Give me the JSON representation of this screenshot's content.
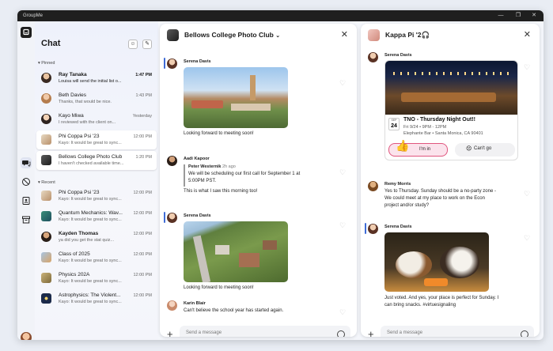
{
  "app": {
    "title": "GroupMe"
  },
  "window_controls": {
    "minimize": "—",
    "maximize": "❐",
    "close": "✕"
  },
  "sidebar": {
    "title": "Chat",
    "pinned_label": "Pinned",
    "recent_label": "Recent",
    "pinned": [
      {
        "name": "Ray Tanaka",
        "preview": "Louisa will send the initial list o...",
        "time": "1:47 PM",
        "unread": true
      },
      {
        "name": "Beth Davies",
        "preview": "Thanks, that would be nice.",
        "time": "1:43 PM",
        "unread": false
      },
      {
        "name": "Kayo Miwa",
        "preview": "I reviewed with the client on...",
        "time": "Yesterday",
        "unread": false
      },
      {
        "name": "Phi Coppa Psi '23",
        "preview": "Kayo: It would be great to sync...",
        "time": "12:00 PM",
        "unread": false
      },
      {
        "name": "Bellows College Photo Club",
        "preview": "I haven't checked available time...",
        "time": "1:20 PM",
        "unread": false
      }
    ],
    "recent": [
      {
        "name": "Phi Coppa Psi '23",
        "preview": "Kayo: It would be great to sync...",
        "time": "12:00 PM"
      },
      {
        "name": "Quantum Mechanics: Wav...",
        "preview": "Kayo: It would be great to sync...",
        "time": "12:00 PM"
      },
      {
        "name": "Kayden Thomas",
        "preview": "ya did you get the stat quiz...",
        "time": "12:00 PM"
      },
      {
        "name": "Class of 2025",
        "preview": "Kayo: It would be great to sync...",
        "time": "12:00 PM"
      },
      {
        "name": "Physics 202A",
        "preview": "Kayo: It would be great to sync...",
        "time": "12:00 PM"
      },
      {
        "name": "Astrophysics: The Violent...",
        "preview": "Kayo: It would be great to sync...",
        "time": "12:00 PM"
      }
    ]
  },
  "chat1": {
    "title": "Bellows College Photo Club",
    "messages": [
      {
        "sender": "Serena Davis",
        "text": "Looking forward to meeting soon!"
      },
      {
        "sender": "Aadi Kapoor",
        "reply_sender": "Peter Westernik",
        "reply_time": "2h ago",
        "reply_text_1": "We will be scheduling our first call for September 1 at",
        "reply_text_2": "5:00PM PST.",
        "text": "This is what I saw this morning too!"
      },
      {
        "sender": "Serena Davis",
        "text": "Looking forward to meeting soon!"
      },
      {
        "sender": "Karin Blair",
        "text": "Can't believe the school year has started again."
      }
    ],
    "composer_placeholder": "Send a message"
  },
  "chat2": {
    "title": "Kappa Pi '2🎧",
    "event": {
      "sender": "Serena Davis",
      "month": "SEP",
      "day": "24",
      "title": "TNO - Thursday Night Out!!",
      "when": "Fri 9/24 • 9PM - 12PM",
      "where": "Elephante Bar • Santa Monica, CA 90401",
      "going": "I'm in",
      "not_going": "Can't go"
    },
    "messages": [
      {
        "sender": "Remy Morris",
        "text_1": "Yes to Thursday. Sunday should be a no-party zone -",
        "text_2": "We could meet at my place to work on the Econ",
        "text_3": "project and/or study?"
      },
      {
        "sender": "Serena Davis",
        "text_1": "Just voted. And yes, your place is perfect for Sunday. I",
        "text_2": "can bring snacks. #virtuesignaling"
      }
    ],
    "composer_placeholder": "Send a message"
  },
  "colors": {
    "accent": "#3e6bd6",
    "going_bg": "#fbe3ec",
    "going_border": "#e0567e"
  }
}
